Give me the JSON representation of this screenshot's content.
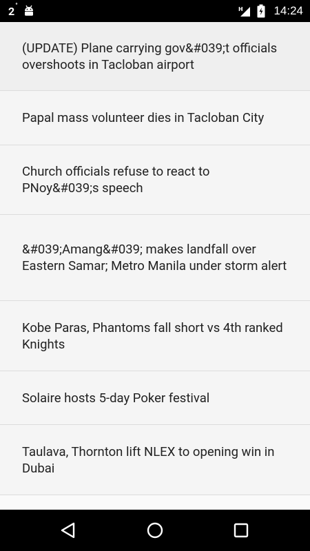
{
  "status_bar": {
    "notification_count": "2",
    "time": "14:24",
    "icons": {
      "left": [
        "notification-count-icon",
        "android-icon"
      ],
      "right": [
        "signal-icon",
        "battery-charging-icon"
      ]
    }
  },
  "news": {
    "items": [
      {
        "title": "(UPDATE) Plane carrying gov&#039;t officials overshoots in Tacloban airport"
      },
      {
        "title": "Papal mass volunteer dies in Tacloban City"
      },
      {
        "title": "Church officials refuse to react to PNoy&#039;s speech"
      },
      {
        "title": "&#039;Amang&#039; makes landfall over Eastern Samar; Metro Manila under storm alert"
      },
      {
        "title": "Kobe Paras, Phantoms fall short vs 4th ranked Knights"
      },
      {
        "title": "Solaire hosts 5-day Poker festival"
      },
      {
        "title": "Taulava, Thornton lift NLEX to opening win in Dubai"
      }
    ]
  },
  "nav_bar": {
    "icons": [
      "back-icon",
      "home-icon",
      "recents-icon"
    ]
  },
  "colors": {
    "status_bar_bg": "#000000",
    "list_bg": "#f5f5f5",
    "divider": "#dcdcdc",
    "text": "#212121"
  }
}
